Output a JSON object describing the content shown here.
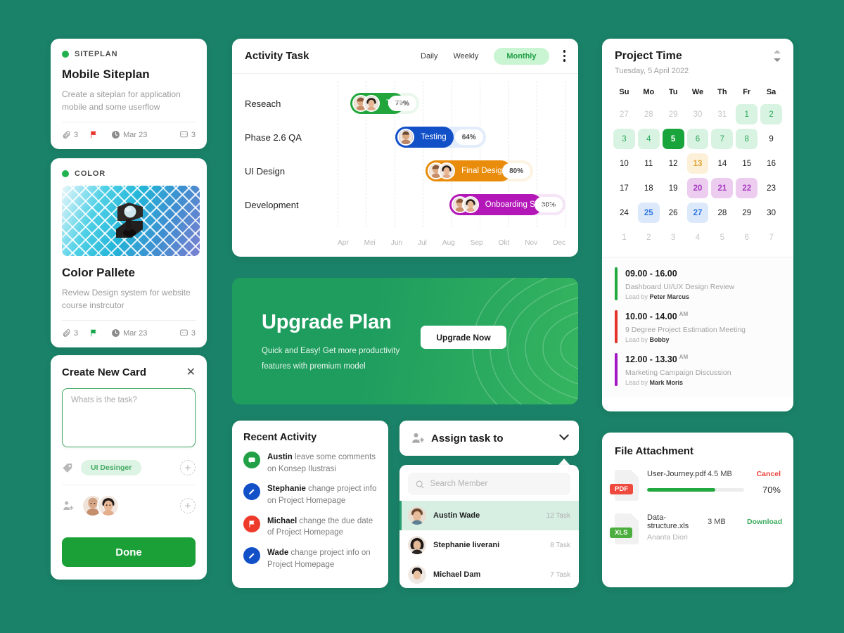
{
  "theme": {
    "background": "#1a8268",
    "accent": "#21a045",
    "brand_green": "#1aa037"
  },
  "cards": [
    {
      "kicker": "SITEPLAN",
      "title": "Mobile Siteplan",
      "desc": "Create a siteplan for application mobile and some userflow",
      "attachments": "3",
      "flag_color": "#e8322a",
      "date": "Mar 23",
      "comments": "3"
    },
    {
      "kicker": "COLOR",
      "title": "Color Pallete",
      "desc": "Review Design system for website course instrcutor",
      "attachments": "3",
      "flag_color": "#17a64a",
      "date": "Mar 23",
      "comments": "3"
    }
  ],
  "create_card": {
    "title": "Create New Card",
    "close_icon": "close-icon",
    "textarea_placeholder": "Whats is the task?",
    "textarea_value": "",
    "tag": "UI Desinger",
    "add_tag_label": "+",
    "add_member_label": "+",
    "done_label": "Done"
  },
  "activity": {
    "title": "Activity Task",
    "tabs": [
      {
        "label": "Daily",
        "active": false
      },
      {
        "label": "Weekly",
        "active": false
      },
      {
        "label": "Monthly",
        "active": true
      }
    ],
    "menu_icon": "kebab-menu-icon"
  },
  "chart_data": {
    "type": "bar",
    "title": "Activity Task",
    "orientation": "horizontal",
    "grid": true,
    "legend": "none",
    "xlabel": "",
    "ylabel": "",
    "categories": [
      "Reseach",
      "Phase 2.6 QA",
      "UI Design",
      "Development"
    ],
    "tick_labels": [
      "Apr",
      "Mei",
      "Jun",
      "Jul",
      "Aug",
      "Sep",
      "Okt",
      "Nov",
      "Dec"
    ],
    "series": [
      {
        "name": "Reseach",
        "label": "Tags",
        "value": 79,
        "value_label": "79%",
        "color": "#22a63c",
        "track_color": "#e9f7ec",
        "start_pct": 0,
        "end_pct": 32,
        "avatars": 2
      },
      {
        "name": "Phase 2.6 QA",
        "label": "Testing",
        "value": 64,
        "value_label": "64%",
        "color": "#1250c8",
        "track_color": "#e3ecfb",
        "start_pct": 21,
        "end_pct": 63,
        "avatars": 1
      },
      {
        "name": "UI Design",
        "label": "Final Design",
        "value": 80,
        "value_label": "80%",
        "color": "#ea8c0b",
        "track_color": "#fdf3e3",
        "start_pct": 35,
        "end_pct": 85,
        "avatars": 2
      },
      {
        "name": "Development",
        "label": "Onboarding Screen",
        "value": 80,
        "value_label": "80%",
        "color": "#b417b8",
        "track_color": "#f6e4f7",
        "start_pct": 46,
        "end_pct": 100,
        "avatars": 2
      }
    ]
  },
  "banner": {
    "heading": "Upgrade Plan",
    "line1": "Quick and Easy! Get more productivity",
    "line2": "features with premium model",
    "button": "Upgrade Now"
  },
  "recent_activity": {
    "title": "Recent Activity",
    "items": [
      {
        "user": "Austin",
        "text": " leave some comments on Konsep Ilustrasi",
        "icon": "comment-icon",
        "color": "#21a045"
      },
      {
        "user": "Stephanie",
        "text": " change project info on Project Homepage",
        "icon": "pencil-icon",
        "color": "#1250c8"
      },
      {
        "user": "Michael",
        "text": " change the due date of Project Homepage",
        "icon": "flag-icon",
        "color": "#ee3a2b"
      },
      {
        "user": "Wade",
        "text": " change project info on Project Homepage",
        "icon": "pencil-icon",
        "color": "#1250c8"
      }
    ]
  },
  "assign": {
    "label": "Assign task to",
    "user_icon": "user-add-icon",
    "chevron": "chevron-down-icon",
    "search_placeholder": "Search Member",
    "search_value": "",
    "search_icon": "search-icon",
    "members": [
      {
        "name": "Austin Wade",
        "tasks": "12 Task",
        "selected": true
      },
      {
        "name": "Stephanie liverani",
        "tasks": "8 Task",
        "selected": false
      },
      {
        "name": "Michael Dam",
        "tasks": "7 Task",
        "selected": false
      }
    ]
  },
  "project_time": {
    "title": "Project Time",
    "subtitle": "Tuesday, 5 April 2022",
    "dow": [
      "Su",
      "Mo",
      "Tu",
      "We",
      "Th",
      "Fr",
      "Sa"
    ],
    "days": [
      {
        "n": "27",
        "state": "mute"
      },
      {
        "n": "28",
        "state": "mute"
      },
      {
        "n": "29",
        "state": "mute"
      },
      {
        "n": "30",
        "state": "mute"
      },
      {
        "n": "31",
        "state": "mute"
      },
      {
        "n": "1",
        "state": "green-soft"
      },
      {
        "n": "2",
        "state": "green-soft"
      },
      {
        "n": "3",
        "state": "green-soft"
      },
      {
        "n": "4",
        "state": "green-soft"
      },
      {
        "n": "5",
        "state": "green-solid"
      },
      {
        "n": "6",
        "state": "green-soft"
      },
      {
        "n": "7",
        "state": "green-soft"
      },
      {
        "n": "8",
        "state": "green-soft"
      },
      {
        "n": "9",
        "state": "plain"
      },
      {
        "n": "10",
        "state": "plain"
      },
      {
        "n": "11",
        "state": "plain"
      },
      {
        "n": "12",
        "state": "plain"
      },
      {
        "n": "13",
        "state": "amber"
      },
      {
        "n": "14",
        "state": "plain"
      },
      {
        "n": "15",
        "state": "plain"
      },
      {
        "n": "16",
        "state": "plain"
      },
      {
        "n": "17",
        "state": "plain"
      },
      {
        "n": "18",
        "state": "plain"
      },
      {
        "n": "19",
        "state": "plain"
      },
      {
        "n": "20",
        "state": "purple"
      },
      {
        "n": "21",
        "state": "purple"
      },
      {
        "n": "22",
        "state": "purple"
      },
      {
        "n": "23",
        "state": "plain"
      },
      {
        "n": "24",
        "state": "plain"
      },
      {
        "n": "25",
        "state": "blue"
      },
      {
        "n": "26",
        "state": "plain"
      },
      {
        "n": "27",
        "state": "blue"
      },
      {
        "n": "28",
        "state": "plain"
      },
      {
        "n": "29",
        "state": "plain"
      },
      {
        "n": "30",
        "state": "plain"
      },
      {
        "n": "1",
        "state": "mute"
      },
      {
        "n": "2",
        "state": "mute"
      },
      {
        "n": "3",
        "state": "mute"
      },
      {
        "n": "4",
        "state": "mute"
      },
      {
        "n": "5",
        "state": "mute"
      },
      {
        "n": "6",
        "state": "mute"
      },
      {
        "n": "7",
        "state": "mute"
      }
    ],
    "schedule": [
      {
        "time": "09.00 - 16.00",
        "ampm": "",
        "desc": "Dashboard UI/UX Design Review",
        "lead_prefix": "Lead by ",
        "lead": "Peter Marcus",
        "color": "#21a83e"
      },
      {
        "time": "10.00 - 14.00",
        "ampm": "AM",
        "desc": "9 Degree Project Estimation Meeting",
        "lead_prefix": "Lead by ",
        "lead": "Bobby",
        "color": "#e4342a"
      },
      {
        "time": "12.00 - 13.30",
        "ampm": "AM",
        "desc": "Marketing Campaign Discussion",
        "lead_prefix": "Lead by ",
        "lead": "Mark Moris",
        "color": "#a118c4"
      }
    ]
  },
  "file_attachment": {
    "title": "File Attachment",
    "files": [
      {
        "badge": "PDF",
        "badge_color": "#ef4a3e",
        "name": "User-Journey.pdf",
        "size": "4.5 MB",
        "action": "Cancel",
        "action_color": "#e8433a",
        "progress": 70,
        "progress_label": "70%",
        "sub": ""
      },
      {
        "badge": "XLS",
        "badge_color": "#4cae3f",
        "name": "Data-structure.xls",
        "size": "3 MB",
        "action": "Download",
        "action_color": "#3cab5c",
        "progress": null,
        "progress_label": "",
        "sub": "Ananta Diori"
      }
    ]
  }
}
